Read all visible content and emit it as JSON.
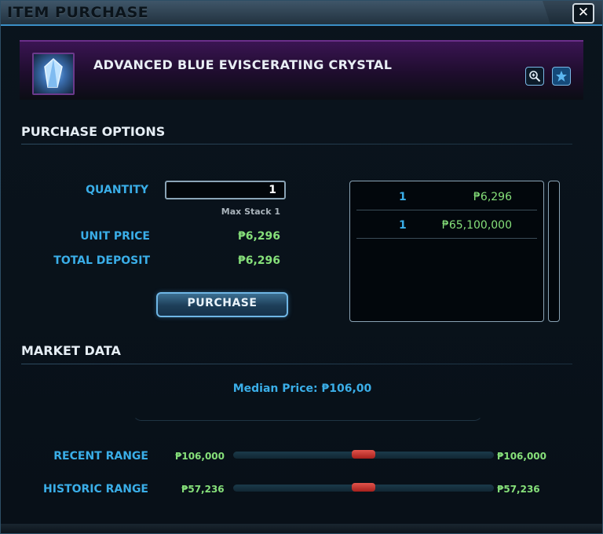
{
  "window": {
    "title": "ITEM PURCHASE",
    "close_label": "✕"
  },
  "item": {
    "name": "ADVANCED BLUE EVISCERATING CRYSTAL",
    "icon": "crystal-icon"
  },
  "purchase_options": {
    "heading": "PURCHASE OPTIONS",
    "quantity_label": "QUANTITY",
    "quantity_value": "1",
    "max_stack": "Max Stack 1",
    "unit_price_label": "UNIT PRICE",
    "unit_price": "₱6,296",
    "total_deposit_label": "TOTAL DEPOSIT",
    "total_deposit": "₱6,296",
    "purchase_button": "PURCHASE"
  },
  "listings": [
    {
      "qty": "1",
      "price": "₱6,296"
    },
    {
      "qty": "1",
      "price": "₱65,100,000"
    }
  ],
  "market_data": {
    "heading": "MARKET DATA",
    "median_label": "Median Price:",
    "median_value": "₱106,00",
    "recent_label": "RECENT RANGE",
    "recent_low": "₱106,000",
    "recent_high": "₱106,000",
    "recent_level": 0.5,
    "historic_label": "HISTORIC RANGE",
    "historic_low": "₱57,236",
    "historic_high": "₱57,236",
    "historic_level": 0.5
  },
  "colors": {
    "accent_blue": "#3aaee8",
    "credit_green": "#86e07a",
    "header_purple": "#3a1452",
    "marker_red": "#c83a33"
  }
}
